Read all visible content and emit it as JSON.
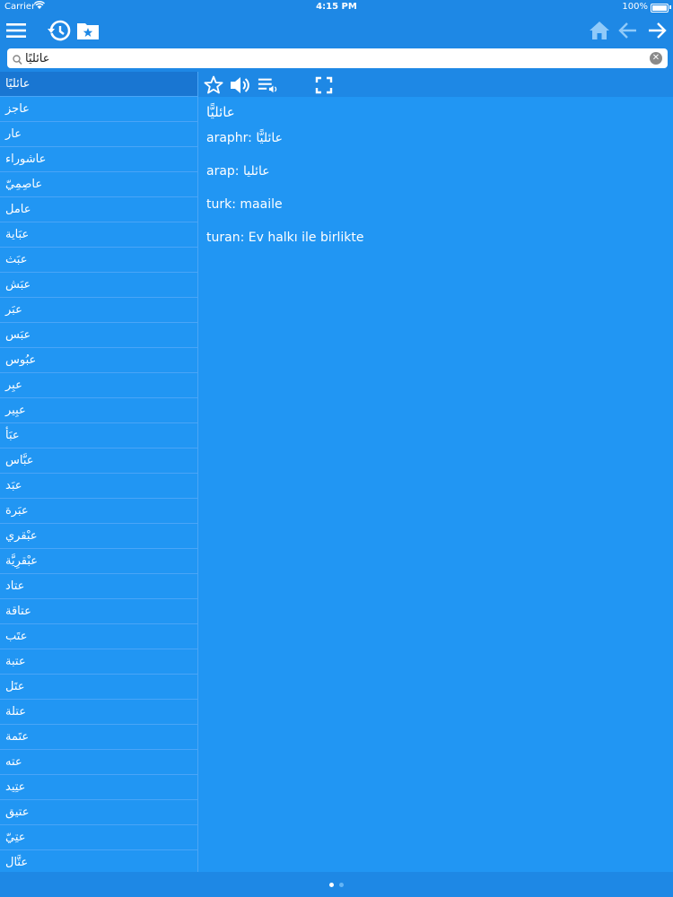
{
  "status_bar": {
    "carrier": "Carrier",
    "time": "4:15 PM",
    "battery": "100%"
  },
  "toolbar": {
    "icons": [
      "menu-icon",
      "history-icon",
      "favorites-folder-icon",
      "home-icon",
      "back-arrow-icon",
      "forward-arrow-icon"
    ]
  },
  "search": {
    "value": "عائليًا",
    "placeholder": ""
  },
  "word_list": {
    "items": [
      "عائليًا",
      "عاجز",
      "عار",
      "عاشوراء",
      "عاصِمِيّ",
      "عامل",
      "عبَاية",
      "عبَث",
      "عبَش",
      "عبَر",
      "عبَس",
      "عبُوس",
      "عبِر",
      "عبِير",
      "عبَأ",
      "عبَّاس",
      "عبَد",
      "عبَرة",
      "عبْقري",
      "عبْقرِيَّة",
      "عتاد",
      "عتاقة",
      "عتَب",
      "عتبة",
      "عتَل",
      "عتلة",
      "عتَمة",
      "عته",
      "عتِيد",
      "عتيق",
      "عتِيّ",
      "عتَّال"
    ],
    "selected_index": 0
  },
  "detail_toolbar": {
    "icons": [
      "star-icon",
      "speaker-icon",
      "playlist-audio-icon",
      "fullscreen-icon"
    ]
  },
  "detail": {
    "headword": "عائليًّا",
    "entries": [
      {
        "label": "araphr:",
        "value": "عائليًّا"
      },
      {
        "label": "arap:",
        "value": "عائليا"
      },
      {
        "label": "turk:",
        "value": "maaile"
      },
      {
        "label": "turan:",
        "value": "Ev halkı ile birlikte"
      }
    ]
  },
  "pager": {
    "pages": 2,
    "current": 1
  },
  "colors": {
    "background": "#2196F3",
    "bar": "#1E88E5",
    "selected": "#1976D2",
    "icon": "#FFFFFF",
    "home_icon": "#90CAF9"
  }
}
